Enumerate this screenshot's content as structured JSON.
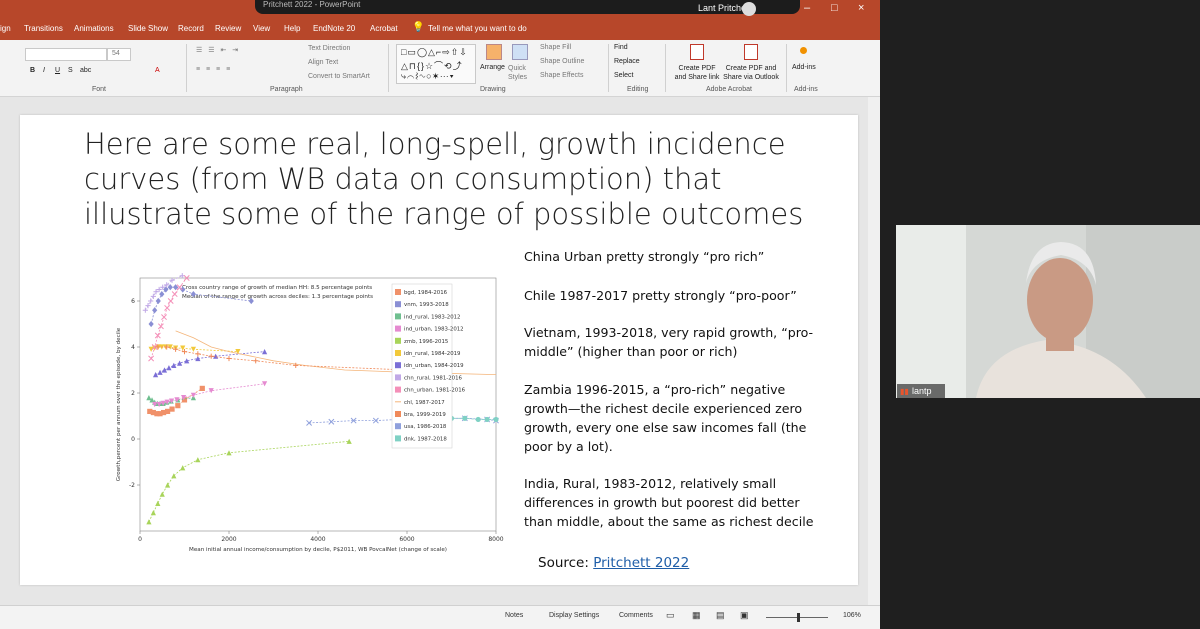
{
  "window": {
    "title": "Pritchett 2022 - PowerPoint",
    "user": "Lant Pritchett",
    "controls": [
      "–",
      "□",
      "×"
    ]
  },
  "ribbon_tabs": [
    "ign",
    "Transitions",
    "Animations",
    "Slide Show",
    "Record",
    "Review",
    "View",
    "Help",
    "EndNote 20",
    "Acrobat",
    "Tell me what you want to do"
  ],
  "ribbon": {
    "font_size": "54",
    "groups": {
      "font": "Font",
      "paragraph": "Paragraph",
      "drawing": "Drawing",
      "editing": "Editing",
      "acrobat": "Adobe Acrobat",
      "addins": "Add-ins"
    },
    "text_direction": "Text Direction",
    "align_text": "Align Text",
    "convert_smartart": "Convert to SmartArt",
    "arrange": "Arrange",
    "quick_styles": "Quick Styles",
    "shape_fill": "Shape Fill",
    "shape_outline": "Shape Outline",
    "shape_effects": "Shape Effects",
    "find": "Find",
    "replace": "Replace",
    "select": "Select",
    "create_pdf_link": "Create PDF and Share link",
    "create_pdf_outlook": "Create PDF and Share via Outlook",
    "addins": "Add-ins"
  },
  "slide": {
    "title": "Here are some real, long-spell, growth incidence curves (from WB data on consumption) that illustrate some of the range of possible outcomes",
    "bullets": [
      "China Urban pretty strongly “pro rich”",
      "Chile 1987-2017 pretty strongly “pro-poor”",
      "Vietnam, 1993-2018, very rapid growth, “pro-middle” (higher than poor or rich)",
      "Zambia 1996-2015, a “pro-rich” negative growth—the richest decile experienced zero growth, every one else saw incomes fall (the poor by a lot).",
      "India, Rural, 1983-2012, relatively small differences in growth but poorest did better than middle, about the same as richest decile"
    ],
    "source_label": "Source:",
    "source_link": "Pritchett 2022"
  },
  "status": {
    "notes": "Notes",
    "display_settings": "Display Settings",
    "comments": "Comments",
    "zoom": "106%"
  },
  "video": {
    "name": "lantp",
    "signal_color": "#e8552d"
  },
  "chart_data": {
    "type": "scatter",
    "title": "",
    "annotations": [
      "Cross country range of growth of median HH: 8.5 percentage points",
      "Median of the range of growth across deciles: 1.3 percentage points"
    ],
    "xlabel": "Mean initial annual income/consumption by decile, P$2011, WB PovcalNet (change of scale)",
    "ylabel": "Growth,percent per annum over the episode, by decile",
    "xlim": [
      0,
      8000
    ],
    "ylim": [
      -4,
      7
    ],
    "xticks": [
      0,
      2000,
      4000,
      6000,
      8000
    ],
    "yticks": [
      -2,
      0,
      2,
      4,
      6
    ],
    "legend_position": "top-right",
    "series": [
      {
        "name": "bgd, 1984-2016",
        "color": "#f0916a",
        "marker": "square",
        "x": [
          220,
          300,
          380,
          450,
          530,
          620,
          720,
          850,
          1000,
          1400
        ],
        "y": [
          1.2,
          1.15,
          1.1,
          1.1,
          1.15,
          1.2,
          1.3,
          1.45,
          1.7,
          2.2
        ]
      },
      {
        "name": "vnm, 1993-2018",
        "color": "#8a8fd4",
        "marker": "diamond",
        "x": [
          250,
          330,
          410,
          490,
          580,
          680,
          800,
          960,
          1200,
          2500
        ],
        "y": [
          5.0,
          5.6,
          6.0,
          6.3,
          6.5,
          6.6,
          6.6,
          6.5,
          6.3,
          6.0
        ]
      },
      {
        "name": "ind_rural, 1983-2012",
        "color": "#6fbf8f",
        "marker": "triangle",
        "x": [
          200,
          270,
          330,
          390,
          450,
          520,
          600,
          700,
          850,
          1200
        ],
        "y": [
          1.8,
          1.7,
          1.6,
          1.55,
          1.55,
          1.55,
          1.6,
          1.65,
          1.7,
          1.8
        ]
      },
      {
        "name": "ind_urban, 1983-2012",
        "color": "#e58ad0",
        "marker": "triangle-down",
        "x": [
          330,
          430,
          520,
          610,
          710,
          830,
          980,
          1200,
          1600,
          2800
        ],
        "y": [
          1.5,
          1.5,
          1.55,
          1.6,
          1.65,
          1.7,
          1.8,
          1.9,
          2.1,
          2.4
        ]
      },
      {
        "name": "zmb, 1996-2015",
        "color": "#a8d45a",
        "marker": "triangle",
        "x": [
          200,
          300,
          400,
          500,
          620,
          760,
          960,
          1300,
          2000,
          4700
        ],
        "y": [
          -3.6,
          -3.2,
          -2.8,
          -2.4,
          -2.0,
          -1.6,
          -1.25,
          -0.9,
          -0.6,
          -0.1
        ]
      },
      {
        "name": "idn_rural, 1984-2019",
        "color": "#f2c93a",
        "marker": "triangle-down",
        "x": [
          250,
          330,
          410,
          490,
          580,
          680,
          800,
          960,
          1200,
          2200
        ],
        "y": [
          3.9,
          3.95,
          4.0,
          4.0,
          4.0,
          4.0,
          3.95,
          3.95,
          3.9,
          3.8
        ]
      },
      {
        "name": "idn_urban, 1984-2019",
        "color": "#7b6fd6",
        "marker": "triangle",
        "x": [
          350,
          450,
          550,
          650,
          760,
          890,
          1050,
          1300,
          1700,
          2800
        ],
        "y": [
          2.8,
          2.9,
          3.0,
          3.1,
          3.2,
          3.3,
          3.4,
          3.5,
          3.6,
          3.8
        ]
      },
      {
        "name": "chn_rural, 1981-2016",
        "color": "#c0a8e6",
        "marker": "plus",
        "x": [
          120,
          180,
          240,
          300,
          360,
          430,
          510,
          600,
          720,
          950
        ],
        "y": [
          5.6,
          5.8,
          6.0,
          6.2,
          6.4,
          6.5,
          6.6,
          6.7,
          6.9,
          7.1
        ]
      },
      {
        "name": "chn_urban, 1981-2016",
        "color": "#f48fb8",
        "marker": "x",
        "x": [
          250,
          330,
          400,
          470,
          540,
          610,
          690,
          780,
          890,
          1050
        ],
        "y": [
          3.5,
          4.0,
          4.5,
          4.9,
          5.3,
          5.7,
          6.0,
          6.3,
          6.6,
          7.0
        ]
      },
      {
        "name": "chl, 1987-2017",
        "color": "#f4b57a",
        "marker": "line",
        "x": [
          800,
          1200,
          1600,
          2000,
          2500,
          3000,
          3700,
          4600,
          6000,
          8000
        ],
        "y": [
          4.7,
          4.4,
          4.0,
          3.8,
          3.6,
          3.4,
          3.2,
          3.0,
          2.9,
          2.8
        ]
      },
      {
        "name": "bra, 1999-2019",
        "color": "#f08a5a",
        "marker": "plus",
        "x": [
          400,
          600,
          800,
          1000,
          1300,
          1600,
          2000,
          2600,
          3500,
          6000
        ],
        "y": [
          4.0,
          4.0,
          3.9,
          3.8,
          3.7,
          3.6,
          3.5,
          3.4,
          3.2,
          3.0
        ]
      },
      {
        "name": "usa, 1986-2018",
        "color": "#8fa0dc",
        "marker": "x",
        "x": [
          3800,
          4300,
          4800,
          5300,
          5800,
          6300,
          6800,
          7300,
          7800,
          8000
        ],
        "y": [
          0.7,
          0.75,
          0.8,
          0.8,
          0.85,
          0.85,
          0.9,
          0.9,
          0.85,
          0.8
        ]
      },
      {
        "name": "dnk, 1987-2018",
        "color": "#7fd1c4",
        "marker": "hexagon",
        "x": [
          5800,
          6100,
          6400,
          6700,
          7000,
          7300,
          7600,
          7800,
          8000
        ],
        "y": [
          0.95,
          0.95,
          0.9,
          0.9,
          0.9,
          0.9,
          0.85,
          0.85,
          0.85
        ]
      }
    ]
  }
}
